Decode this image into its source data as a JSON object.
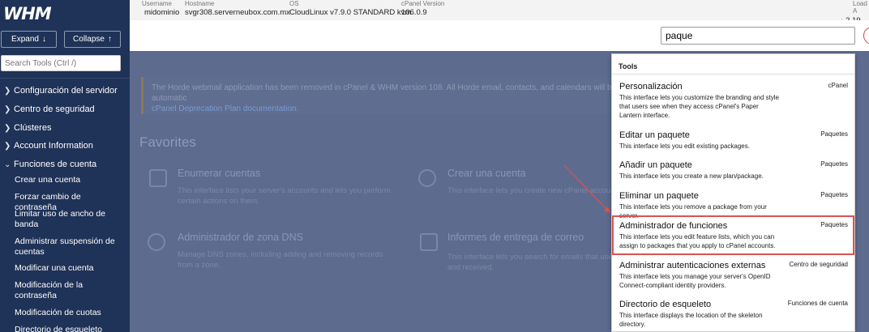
{
  "sidebar": {
    "logo": "WHM",
    "expand_label": "Expand",
    "collapse_label": "Collapse",
    "search_placeholder": "Search Tools (Ctrl /)",
    "sections": [
      {
        "label": "Configuración del servidor"
      },
      {
        "label": "Centro de seguridad"
      },
      {
        "label": "Clústeres"
      },
      {
        "label": "Account Information"
      },
      {
        "label": "Funciones de cuenta"
      }
    ],
    "items": [
      {
        "label": "Crear una cuenta"
      },
      {
        "label": "Forzar cambio de contraseña"
      },
      {
        "label": "Limitar uso de ancho de banda"
      },
      {
        "label": "Administrar suspensión de cuentas"
      },
      {
        "label": "Modificar una cuenta"
      },
      {
        "label": "Modificación de la contraseña"
      },
      {
        "label": "Modificación de cuotas"
      },
      {
        "label": "Directorio de esqueleto"
      }
    ]
  },
  "header": {
    "username_label": "Username",
    "username": "midominio",
    "hostname_label": "Hostname",
    "hostname": "svgr308.serverneubox.com.mx",
    "os_label": "OS",
    "os": "CloudLinux v7.9.0 STANDARD kvm",
    "cpanel_label": "cPanel Version",
    "cpanel": "106.0.9",
    "load_label": "Load A",
    "load": "2.19"
  },
  "search": {
    "value": "paque"
  },
  "main": {
    "notice_text": "The Horde webmail application has been removed in cPanel & WHM version 108. All Horde email, contacts, and calendars will be automatic",
    "notice_link": "cPanel Deprecation Plan documentation.",
    "favorites_title": "Favorites",
    "favorites": [
      {
        "title": "Enumerar cuentas",
        "desc": "This interface lists your server's accounts and lets you perform certain actions on them."
      },
      {
        "title": "Crear una cuenta",
        "desc": "This interface lets you create new cPanel accounts"
      },
      {
        "title": "Administrador de zona DNS",
        "desc": "Manage DNS zones, including adding and removing records from a zone."
      },
      {
        "title": "Informes de entrega de correo",
        "desc": "This interface lets you search for emails that users system sent and received."
      }
    ]
  },
  "dropdown": {
    "header": "Tools",
    "items": [
      {
        "title": "Personalización",
        "desc": "This interface lets you customize the branding and style that users see when they access cPanel's Paper Lantern interface.",
        "category": "cPanel"
      },
      {
        "title": "Editar un paquete",
        "desc": "This interface lets you edit existing packages.",
        "category": "Paquetes"
      },
      {
        "title": "Añadir un paquete",
        "desc": "This interface lets you create a new plan/package.",
        "category": "Paquetes"
      },
      {
        "title": "Eliminar un paquete",
        "desc": "This interface lets you remove a package from your server.",
        "category": "Paquetes"
      },
      {
        "title": "Administrador de funciones",
        "desc": "This interface lets you edit feature lists, which you can assign to packages that you apply to cPanel accounts.",
        "category": "Paquetes"
      },
      {
        "title": "Administrar autenticaciones externas",
        "desc": "This interface lets you manage your server's OpenID Connect-compliant identity providers.",
        "category": "Centro de seguridad"
      },
      {
        "title": "Directorio de esqueleto",
        "desc": "This interface displays the location of the skeleton directory.",
        "category": "Funciones de cuenta"
      }
    ]
  },
  "colors": {
    "highlight": "#d9534f",
    "sidebar": "#1f3257"
  }
}
